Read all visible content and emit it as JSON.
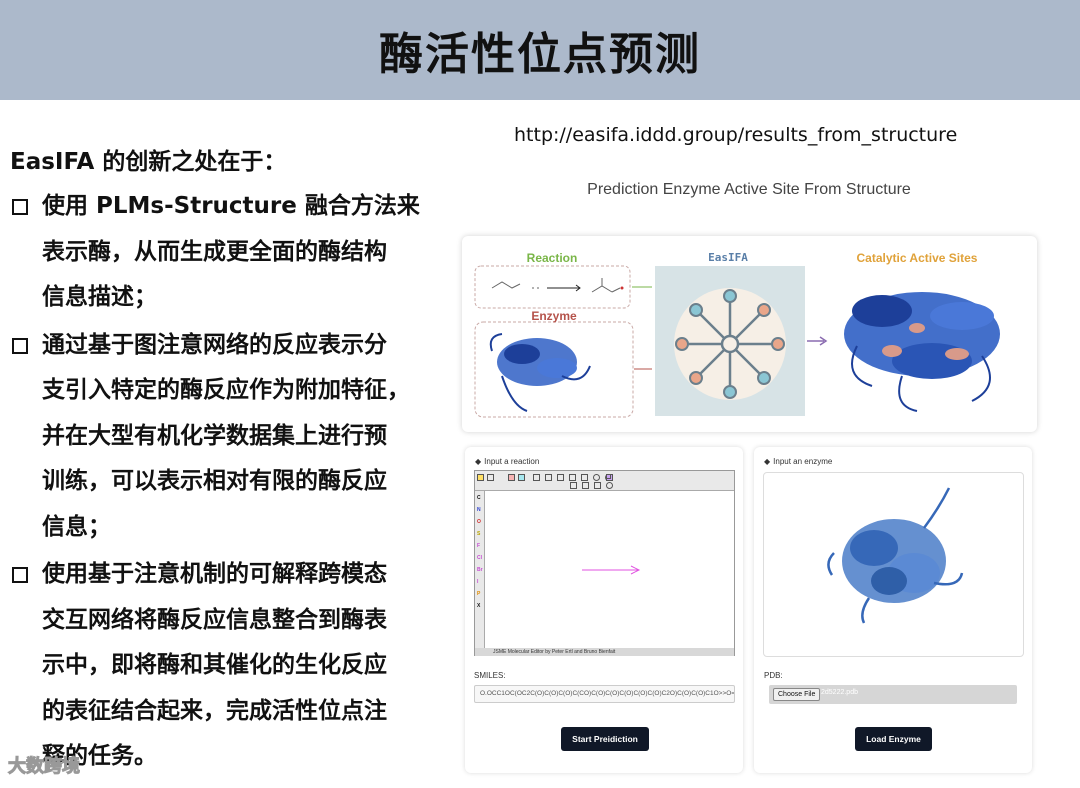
{
  "title": "酶活性位点预测",
  "left": {
    "intro": "EasIFA 的创新之处在于：",
    "bullets": [
      {
        "lines": [
          "使用 PLMs-Structure 融合方法来",
          "表示酶，从而生成更全面的酶结构",
          "信息描述；"
        ]
      },
      {
        "lines": [
          "通过基于图注意网络的反应表示分",
          "支引入特定的酶反应作为附加特征，",
          "并在大型有机化学数据集上进行预",
          "训练，可以表示相对有限的酶反应",
          "信息；"
        ]
      },
      {
        "lines": [
          "使用基于注意机制的可解释跨模态",
          "交互网络将酶反应信息整合到酶表",
          "示中，即将酶和其催化的生化反应",
          "的表征结合起来，完成活性位点注",
          "释的任务。"
        ]
      }
    ]
  },
  "url": "http://easifa.iddd.group/results_from_structure",
  "page_subtitle": "Prediction Enzyme Active Site From Structure",
  "graphic": {
    "reaction_label": "Reaction",
    "enzyme_label": "Enzyme",
    "easifa_label": "EasIFA",
    "sites_label": "Catalytic Active Sites",
    "colors": {
      "reaction": "#7ab648",
      "enzyme": "#b5534b",
      "easifa": "#5a7fa8",
      "sites": "#e0a23a",
      "protein": "#2f5fc4"
    }
  },
  "reaction_card": {
    "label": "Input a reaction",
    "editor_status": "JSME Molecular Editor by Peter Ertl and Bruno Bienfait",
    "smiles_label": "SMILES:",
    "smiles_value": "O.OCC1OC(OC2C(O)C(O)C(O)C(CO)C(O)C(O)C(O)C(O)C(O)C2O)C(O)C(O)C1O>>O=C(C)[C",
    "button": "Start Preidiction"
  },
  "enzyme_card": {
    "label": "Input an enzyme",
    "pdb_label": "PDB:",
    "choose_file": "Choose File",
    "file_name": "2d5222.pdb",
    "button": "Load Enzyme"
  },
  "watermark": "大数跨境"
}
